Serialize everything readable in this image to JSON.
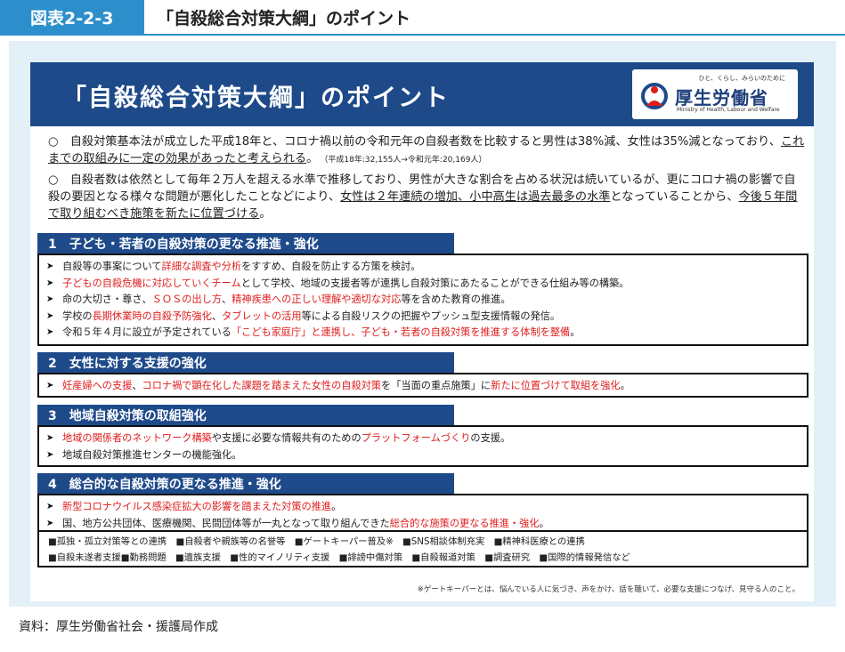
{
  "figure": {
    "label": "図表2-2-3",
    "title": "「自殺総合対策大綱」のポイント"
  },
  "banner": {
    "title": "「自殺総合対策大綱」のポイント",
    "logo_tagline": "ひと、くらし、みらいのために",
    "logo_name": "厚生労働省",
    "logo_en": "Ministry of Health, Labour and Welfare"
  },
  "intro": {
    "p1": {
      "a": "○　自殺対策基本法が成立した平成18年と、コロナ禍以前の令和元年の自殺者数を比較すると男性は38%減、女性は35%減となっており、",
      "b": "これまでの取組みに一定の効果があったと考えられる",
      "c": "。",
      "note": "（平成18年:32,155人→令和元年:20,169人）"
    },
    "p2": {
      "a": "○　自殺者数は依然として毎年２万人を超える水準で推移しており、男性が大きな割合を占める状況は続いているが、更にコロナ禍の影響で自殺の要因となる様々な問題が悪化したことなどにより、",
      "b": "女性は２年連続の増加、小中高生は過去最多の水準",
      "c": "となっていることから、",
      "d": "今後５年間で取り組むべき施策を新たに位置づける",
      "e": "。"
    }
  },
  "sections": [
    {
      "heading": "1　子ども・若者の自殺対策の更なる推進・強化",
      "lines": [
        [
          {
            "t": "自殺等の事案について"
          },
          {
            "t": "詳細な調査や分析",
            "r": true
          },
          {
            "t": "をすすめ、自殺を防止する方策を検討。"
          }
        ],
        [
          {
            "t": "子どもの自殺危機に対応していくチーム",
            "r": true
          },
          {
            "t": "として学校、地域の支援者等が連携し自殺対策にあたることができる仕組み等の構築。"
          }
        ],
        [
          {
            "t": "命の大切さ・尊さ、"
          },
          {
            "t": "ＳＯＳの出し方",
            "r": true
          },
          {
            "t": "、"
          },
          {
            "t": "精神疾患への正しい理解や適切な対応",
            "r": true
          },
          {
            "t": "等を含めた教育の推進。"
          }
        ],
        [
          {
            "t": "学校の"
          },
          {
            "t": "長期休業時の自殺予防強化",
            "r": true
          },
          {
            "t": "、"
          },
          {
            "t": "タブレットの活用",
            "r": true
          },
          {
            "t": "等による自殺リスクの把握やプッシュ型支援情報の発信。"
          }
        ],
        [
          {
            "t": "令和５年４月に設立が予定されている"
          },
          {
            "t": "「こども家庭庁」と連携し、子ども・若者の自殺対策を推進する体制を整備",
            "r": true
          },
          {
            "t": "。"
          }
        ]
      ]
    },
    {
      "heading": "2　女性に対する支援の強化",
      "lines": [
        [
          {
            "t": "妊産婦への支援",
            "r": true
          },
          {
            "t": "、"
          },
          {
            "t": "コロナ禍で顕在化した課題を踏まえた女性の自殺対策",
            "r": true
          },
          {
            "t": "を「当面の重点施策」に"
          },
          {
            "t": "新たに位置づけて取組を強化",
            "r": true
          },
          {
            "t": "。"
          }
        ]
      ]
    },
    {
      "heading": "3　地域自殺対策の取組強化",
      "lines": [
        [
          {
            "t": "地域の関係者のネットワーク構築",
            "r": true
          },
          {
            "t": "や支援に必要な情報共有のための"
          },
          {
            "t": "プラットフォームづくり",
            "r": true
          },
          {
            "t": "の支援。"
          }
        ],
        [
          {
            "t": "地域自殺対策推進センターの機能強化。"
          }
        ]
      ]
    },
    {
      "heading": "4　総合的な自殺対策の更なる推進・強化",
      "lines": [
        [
          {
            "t": "新型コロナウイルス感染症拡大の影響を踏まえた対策の推進",
            "r": true
          },
          {
            "t": "。"
          }
        ],
        [
          {
            "t": "国、地方公共団体、医療機関、民間団体等が一丸となって取り組んできた"
          },
          {
            "t": "総合的な施策の更なる推進・強化",
            "r": true
          },
          {
            "t": "。"
          }
        ]
      ]
    }
  ],
  "tags": {
    "row1": "■孤独・孤立対策等との連携　■自殺者や親族等の名誉等　■ゲートキーパー普及※　■SNS相談体制充実　■精神科医療との連携",
    "row2": "■自殺未遂者支援■勤務問題　■遺族支援　■性的マイノリティ支援　■誹謗中傷対策　■自殺報道対策　■調査研究　■国際的情報発信など"
  },
  "note": "※ゲートキーパーとは、悩んでいる人に気づき、声をかけ、話を聴いて、必要な支援につなげ、見守る人のこと。",
  "source": "資料：厚生労働省社会・援護局作成",
  "colors": {
    "accent": "#2c8fcb",
    "banner": "#1e4a8a",
    "highlight": "#e01d1d",
    "frame_bg": "#e3f0f7"
  },
  "icons": {
    "bullet": "arrow-right-icon",
    "logo": "mhlw-logo-icon"
  }
}
